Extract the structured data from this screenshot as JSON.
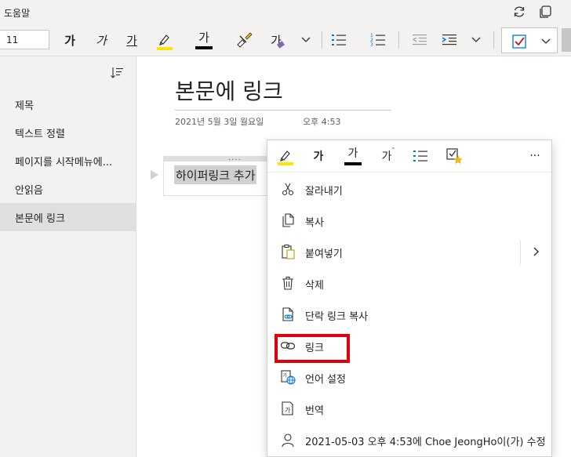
{
  "menubar": {
    "help_label": "도움말"
  },
  "ribbon": {
    "font_size": "11",
    "bold_glyph": "가",
    "italic_glyph": "가",
    "underline_glyph": "가",
    "font_color_glyph": "가",
    "style_glyph": "가",
    "colors": {
      "highlight": "#ffe600",
      "font_color": "#000000",
      "todo_check": "#c50f1f"
    }
  },
  "pagelist": {
    "items": [
      {
        "label": "제목"
      },
      {
        "label": "텍스트 정렬"
      },
      {
        "label": "페이지를 시작메뉴에..."
      },
      {
        "label": "안읽음"
      },
      {
        "label": "본문에 링크"
      }
    ],
    "selected_index": 4
  },
  "note": {
    "title": "본문에 링크",
    "date": "2021년 5월 3일 월요일",
    "time": "오후 4:53",
    "paragraph_text": "하이퍼링크 추가",
    "handle_dots": "...."
  },
  "context_menu": {
    "toolbar": {
      "bold_glyph": "가",
      "font_color_glyph": "가",
      "style_glyph": "가",
      "more_glyph": "···"
    },
    "items": [
      {
        "label": "잘라내기",
        "icon": "scissors-icon"
      },
      {
        "label": "복사",
        "icon": "copy-icon"
      },
      {
        "label": "붙여넣기",
        "icon": "paste-icon"
      },
      {
        "label": "삭제",
        "icon": "trash-icon"
      },
      {
        "label": "단락 링크 복사",
        "icon": "paragraph-link-icon"
      },
      {
        "label": "링크",
        "icon": "link-icon"
      },
      {
        "label": "언어 설정",
        "icon": "language-icon"
      },
      {
        "label": "번역",
        "icon": "translate-icon"
      },
      {
        "label": "2021-05-03 오후 4:53에 Choe JeongHo이(가) 수정",
        "icon": "person-icon"
      }
    ],
    "highlight_color": "#e0000b"
  }
}
